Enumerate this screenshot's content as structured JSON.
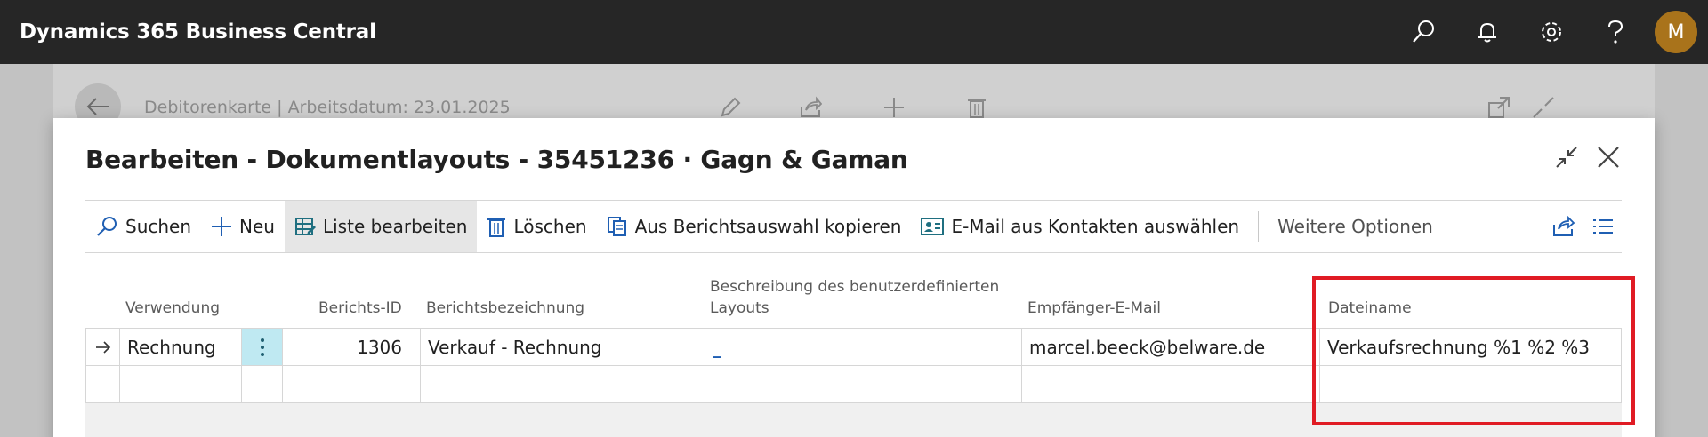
{
  "app": {
    "title": "Dynamics 365 Business Central",
    "user_initial": "M",
    "avatar_color": "#a9731b",
    "icons": [
      "search-icon",
      "bell-icon",
      "gear-icon",
      "help-icon"
    ]
  },
  "background_page": {
    "breadcrumb": "Debitorenkarte | Arbeitsdatum: 23.01.2025"
  },
  "dialog": {
    "title": "Bearbeiten - Dokumentlayouts - 35451236 · Gagn & Gaman",
    "actions": {
      "search": "Suchen",
      "new": "Neu",
      "edit_list": "Liste bearbeiten",
      "delete": "Löschen",
      "copy_from_report": "Aus Berichtsauswahl kopieren",
      "email_from_contacts": "E-Mail aus Kontakten auswählen",
      "more_options": "Weitere Optionen"
    },
    "columns": {
      "usage": "Verwendung",
      "report_id": "Berichts-ID",
      "report_name": "Berichtsbezeichnung",
      "custom_layout_desc_1": "Beschreibung des benutzerdefinierten",
      "custom_layout_desc_2": "Layouts",
      "recipient_email": "Empfänger-E-Mail",
      "file_name": "Dateiname"
    },
    "rows": [
      {
        "usage": "Rechnung",
        "report_id": "1306",
        "report_name": "Verkauf - Rechnung",
        "custom_layout_desc": "_",
        "recipient_email": "marcel.beeck@belware.de",
        "file_name": "Verkaufsrechnung %1 %2 %3"
      }
    ]
  },
  "colors": {
    "appbar": "#262626",
    "highlight": "#e01b24",
    "selected_cell": "#bfe9f2",
    "accent": "#1f5fb3"
  }
}
